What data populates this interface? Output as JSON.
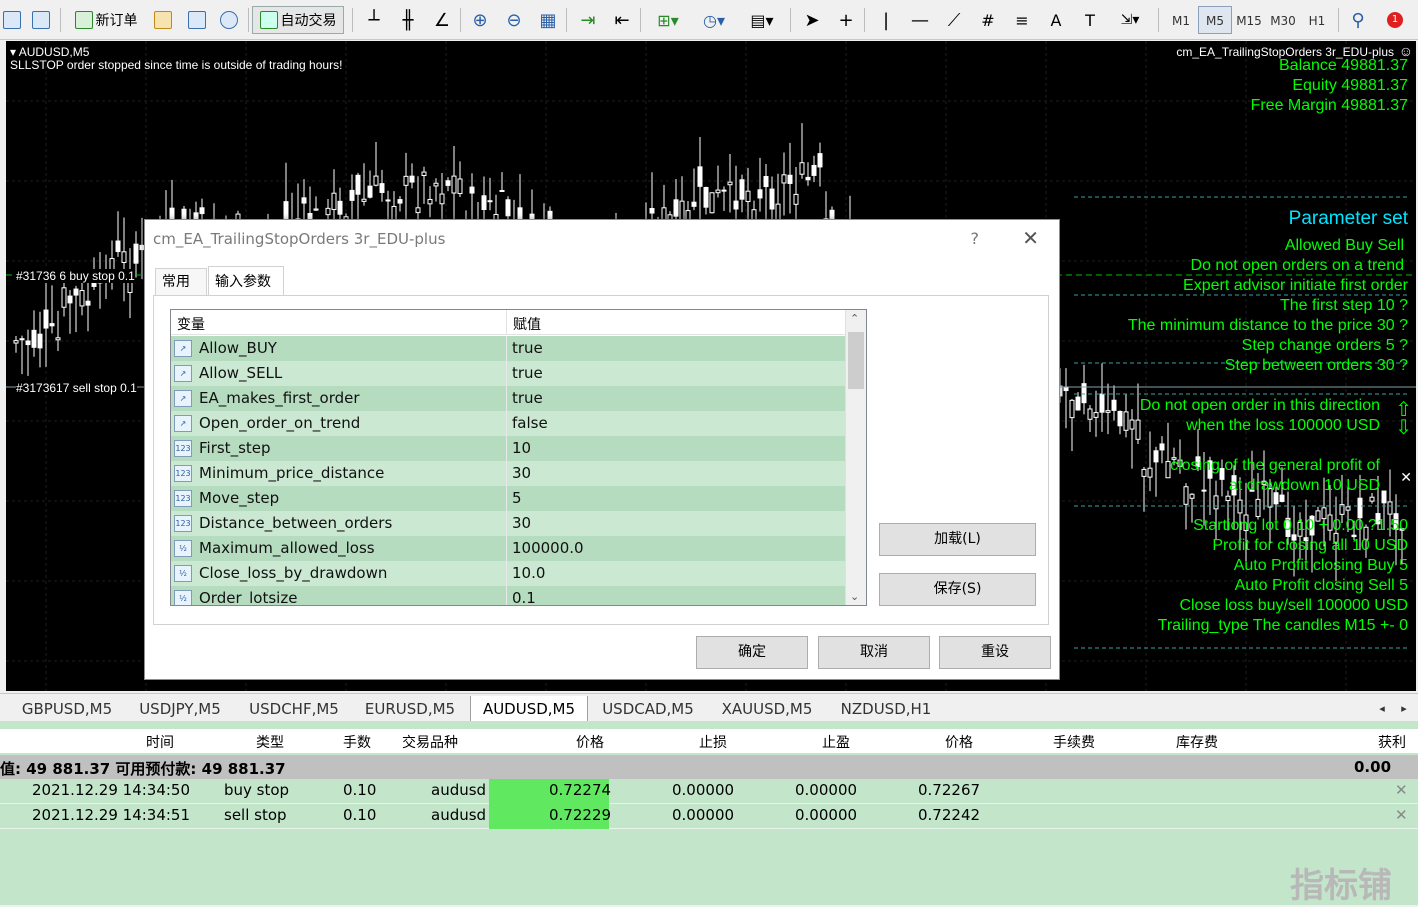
{
  "toolbar": {
    "new_order": "新订单",
    "auto_trade": "自动交易",
    "timeframes": [
      "M1",
      "M5",
      "M15",
      "M30",
      "H1"
    ],
    "active_timeframe": "M5"
  },
  "chart": {
    "symbol_label": "AUDUSD,M5",
    "message": "SLLSTOP order stopped since time is outside of trading hours!",
    "ea_name": "cm_EA_TrailingStopOrders 3r_EDU-plus",
    "order_label_1": "#31736 6 buy stop 0.1",
    "order_label_2": "#3173617 sell stop 0.1",
    "account": [
      "Balance 49881.37",
      "Equity 49881.37",
      "Free Margin 49881.37"
    ],
    "param_title": "Parameter set",
    "param_lines": [
      "Allowed Buy Sell",
      "Do not open orders on a trend",
      "Expert advisor initiate first order",
      "The first step 10 ?",
      "The minimum distance to the price 30 ?",
      "Step change orders 5 ?",
      "Step between orders 30 ?"
    ],
    "direction_lines": [
      "Do not open order in this direction",
      "when the loss 100000 USD"
    ],
    "profit_lines": [
      "closing of the general profit of",
      "at drawdown 10 USD"
    ],
    "lot_lines": [
      "Startiong lot 0.10 + 0.00 ?1.50",
      "Profit for closing all 10 USD",
      "Auto Profit closing Buy 5",
      "Auto Profit closing Sell 5",
      "Close loss buy/sell 100000 USD",
      "Trailing_type The candles M15 +- 0"
    ]
  },
  "dialog": {
    "title": "cm_EA_TrailingStopOrders 3r_EDU-plus",
    "help": "?",
    "tabs": [
      "常用",
      "输入参数"
    ],
    "active_tab": "输入参数",
    "col_variable": "变量",
    "col_value": "赋值",
    "params": [
      {
        "name": "Allow_BUY",
        "value": "true",
        "type": "bool"
      },
      {
        "name": "Allow_SELL",
        "value": "true",
        "type": "bool"
      },
      {
        "name": "EA_makes_first_order",
        "value": "true",
        "type": "bool"
      },
      {
        "name": "Open_order_on_trend",
        "value": "false",
        "type": "bool"
      },
      {
        "name": "First_step",
        "value": "10",
        "type": "int"
      },
      {
        "name": "Minimum_price_distance",
        "value": "30",
        "type": "int"
      },
      {
        "name": "Move_step",
        "value": "5",
        "type": "int"
      },
      {
        "name": "Distance_between_orders",
        "value": "30",
        "type": "int"
      },
      {
        "name": "Maximum_allowed_loss",
        "value": "100000.0",
        "type": "double"
      },
      {
        "name": "Close_loss_by_drawdown",
        "value": "10.0",
        "type": "double"
      },
      {
        "name": "Order_lotsize",
        "value": "0.1",
        "type": "double"
      }
    ],
    "load_button": "加载(L)",
    "save_button": "保存(S)",
    "ok_button": "确定",
    "cancel_button": "取消",
    "reset_button": "重设"
  },
  "symbol_tabs": [
    "GBPUSD,M5",
    "USDJPY,M5",
    "USDCHF,M5",
    "EURUSD,M5",
    "AUDUSD,M5",
    "USDCAD,M5",
    "XAUUSD,M5",
    "NZDUSD,H1"
  ],
  "active_symbol_tab": "AUDUSD,M5",
  "terminal": {
    "headers": [
      "时间",
      "类型",
      "手数",
      "交易品种",
      "价格",
      "止损",
      "止盈",
      "价格",
      "手续费",
      "库存费",
      "获利"
    ],
    "balance_line": "值: 49 881.37  可用预付款: 49 881.37",
    "balance_profit": "0.00",
    "rows": [
      {
        "time": "2021.12.29 14:34:50",
        "type": "buy stop",
        "lots": "0.10",
        "symbol": "audusd",
        "price": "0.72274",
        "sl": "0.00000",
        "tp": "0.00000",
        "cur": "0.72267"
      },
      {
        "time": "2021.12.29 14:34:51",
        "type": "sell stop",
        "lots": "0.10",
        "symbol": "audusd",
        "price": "0.72229",
        "sl": "0.00000",
        "tp": "0.00000",
        "cur": "0.72242"
      }
    ]
  },
  "watermark": "指标铺",
  "colors": {
    "chart_bg": "#000000",
    "candle": "#ffffff",
    "green_text": "#00ff00",
    "cyan_title": "#00e5ff",
    "row_green": "#c3e6cb",
    "price_cell": "#61e861"
  }
}
